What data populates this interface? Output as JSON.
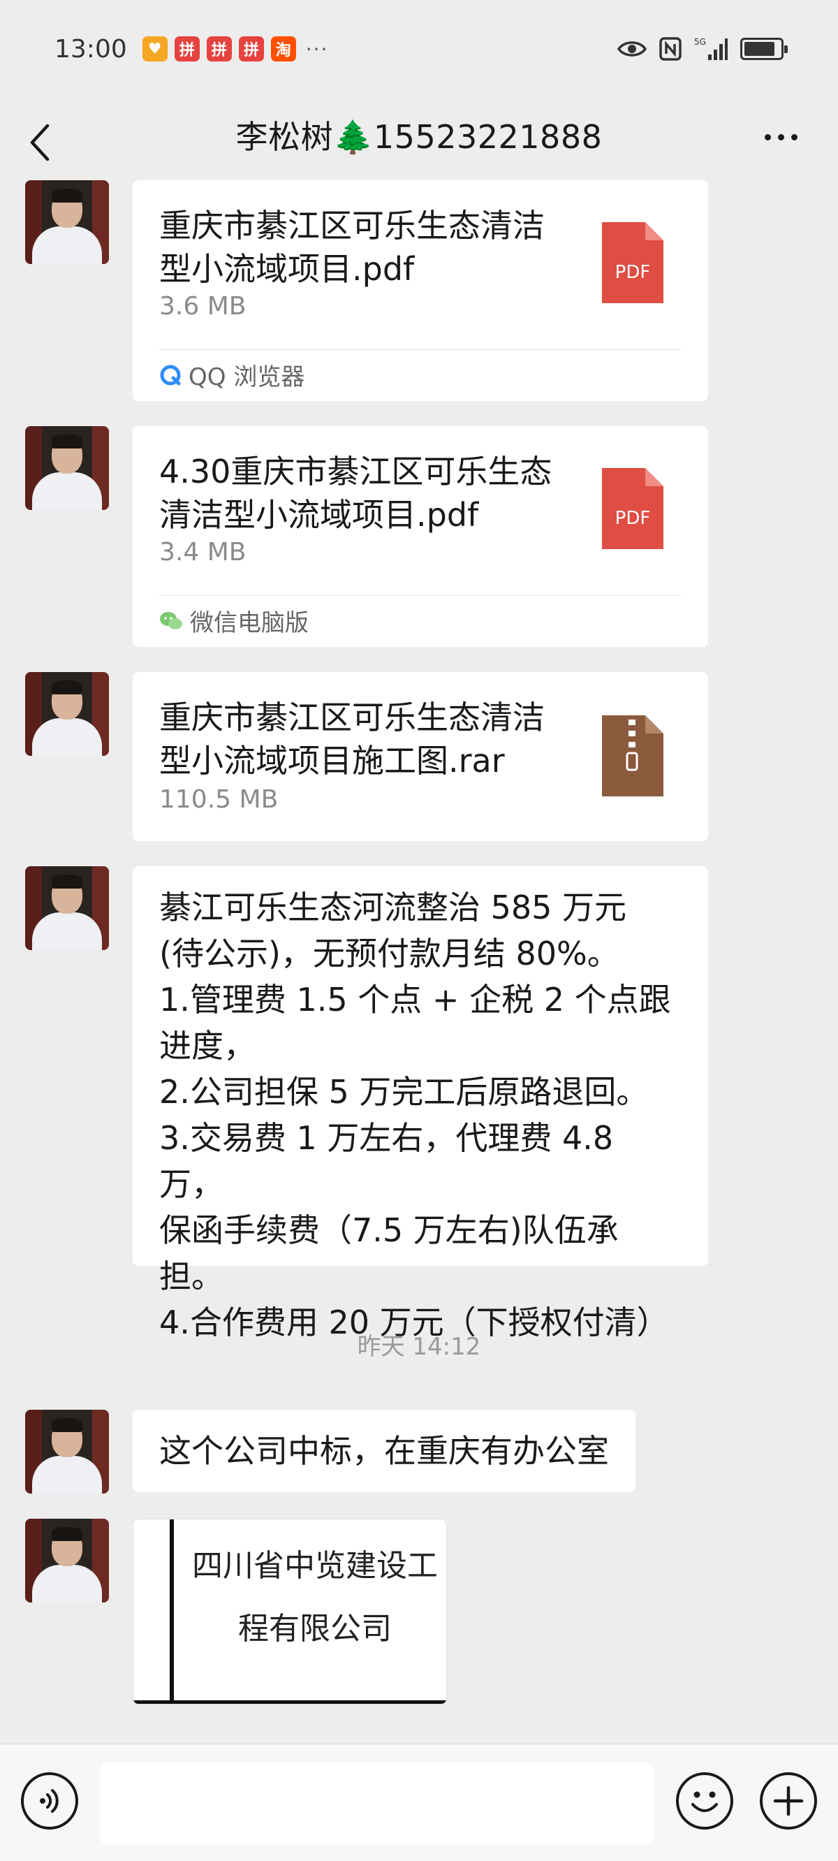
{
  "status_bar": {
    "time": "13:00",
    "notifications": [
      {
        "icon": "shield-app-icon",
        "glyph": "♥",
        "color": "#f5a623"
      },
      {
        "icon": "pinduoduo-icon",
        "glyph": "拼",
        "color": "#e64340"
      },
      {
        "icon": "pinduoduo-icon",
        "glyph": "拼",
        "color": "#e64340"
      },
      {
        "icon": "pinduoduo-icon",
        "glyph": "拼",
        "color": "#e64340"
      },
      {
        "icon": "taobao-icon",
        "glyph": "淘",
        "color": "#ff5000"
      }
    ],
    "more_indicator": "···",
    "signal_label": "5G",
    "battery_level": 0.85
  },
  "header": {
    "title": "李松树🌲15523221888"
  },
  "messages": [
    {
      "type": "file",
      "file_name": "重庆市綦江区可乐生态清洁型小流域项目.pdf",
      "file_size": "3.6 MB",
      "file_icon": "pdf-icon",
      "file_icon_label": "PDF",
      "source_icon": "qq-browser-icon",
      "source": "QQ 浏览器"
    },
    {
      "type": "file",
      "file_name": "4.30重庆市綦江区可乐生态清洁型小流域项目.pdf",
      "file_size": "3.4 MB",
      "file_icon": "pdf-icon",
      "file_icon_label": "PDF",
      "source_icon": "wechat-pc-icon",
      "source": "微信电脑版"
    },
    {
      "type": "file",
      "file_name": "重庆市綦江区可乐生态清洁型小流域项目施工图.rar",
      "file_size": "110.5 MB",
      "file_icon": "zip-archive-icon"
    },
    {
      "type": "text",
      "lines": [
        "綦江可乐生态河流整治 585 万元",
        "(待公示)，无预付款月结 80%。",
        "1.管理费 1.5 个点 + 企税 2 个点跟",
        "进度，",
        "2.公司担保 5 万完工后原路退回。",
        "3.交易费 1 万左右，代理费 4.8 万，",
        "保函手续费（7.5 万左右)队伍承担。",
        "4.合作费用 20 万元（下授权付清）"
      ]
    },
    {
      "type": "timestamp",
      "text": "昨天 14:12"
    },
    {
      "type": "text_short",
      "text": "这个公司中标，在重庆有办公室"
    },
    {
      "type": "image",
      "lines": [
        "四川省中览建设工",
        "程有限公司"
      ]
    }
  ],
  "colors": {
    "background": "#ededed",
    "bubble": "#ffffff",
    "pdf_red": "#e04d43",
    "zip_brown": "#8b5a3c",
    "secondary_text": "#8a8a8a"
  }
}
